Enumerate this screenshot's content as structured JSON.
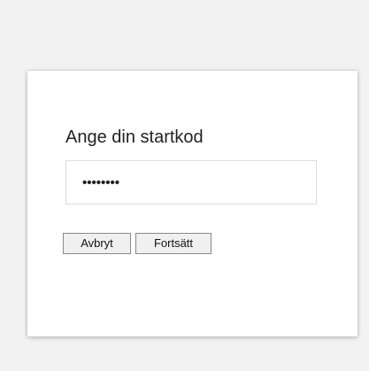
{
  "dialog": {
    "title": "Ange din startkod",
    "pin_value": "••••••••",
    "cancel_label": "Avbryt",
    "continue_label": "Fortsätt"
  },
  "colors": {
    "page_background": "#f2f2f2",
    "card_background": "#ffffff",
    "input_border": "#dcdcdc",
    "button_background": "#f0f0f0",
    "button_border": "#8a8a8a",
    "text": "#222222"
  }
}
